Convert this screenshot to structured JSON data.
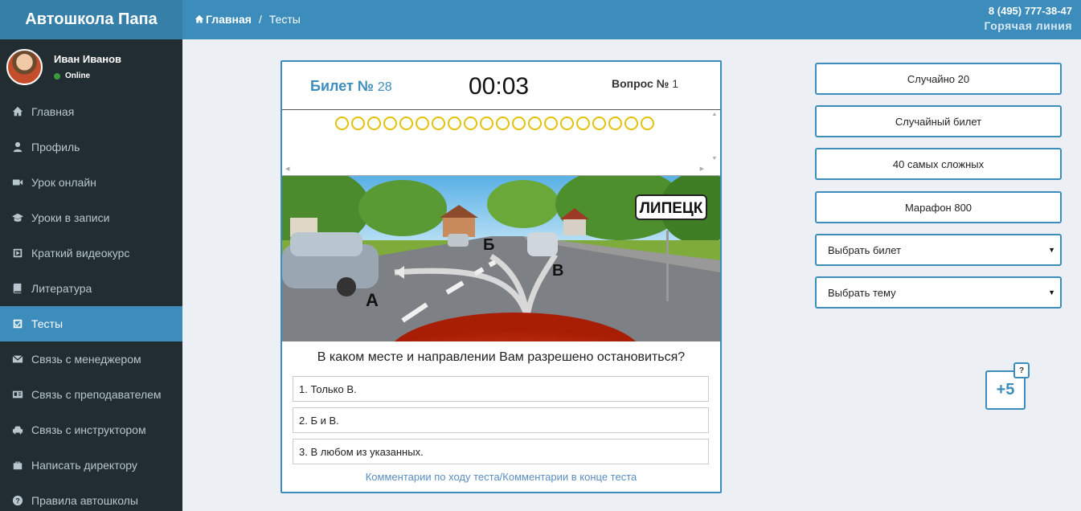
{
  "app": {
    "title": "Автошкола Папа"
  },
  "user": {
    "name": "Иван Иванов",
    "status": "Online"
  },
  "sidebar": {
    "items": [
      {
        "label": "Главная",
        "icon": "home-icon"
      },
      {
        "label": "Профиль",
        "icon": "user-icon"
      },
      {
        "label": "Урок онлайн",
        "icon": "video-camera-icon"
      },
      {
        "label": "Уроки в записи",
        "icon": "graduation-cap-icon"
      },
      {
        "label": "Краткий видеокурс",
        "icon": "play-square-icon"
      },
      {
        "label": "Литература",
        "icon": "book-icon"
      },
      {
        "label": "Тесты",
        "icon": "check-square-icon",
        "active": true
      },
      {
        "label": "Связь с менеджером",
        "icon": "envelope-icon"
      },
      {
        "label": "Связь с преподавателем",
        "icon": "id-card-icon"
      },
      {
        "label": "Связь с инструктором",
        "icon": "car-icon"
      },
      {
        "label": "Написать директору",
        "icon": "briefcase-icon"
      },
      {
        "label": "Правила автошколы",
        "icon": "question-circle-icon"
      }
    ]
  },
  "header": {
    "breadcrumb": {
      "home": "Главная",
      "sep": "/",
      "current": "Тесты"
    },
    "phone": "8 (495) 777-38-47",
    "hotline_label": "Горячая линия"
  },
  "test": {
    "ticket_label": "Билет №",
    "ticket_number": "28",
    "timer": "00:03",
    "question_label": "Вопрос №",
    "question_number": "1",
    "progress_count": 20,
    "scene": {
      "sign": "ЛИПЕЦК",
      "mark_a": "А",
      "mark_b": "Б",
      "mark_c": "В"
    },
    "question": "В каком месте и направлении Вам разрешено остановиться?",
    "answers": [
      "1. Только В.",
      "2. Б и В.",
      "3. В любом из указанных."
    ],
    "comments_link": "Комментарии по ходу теста/Комментарии в конце теста"
  },
  "actions": {
    "random20": "Случайно 20",
    "random_ticket": "Случайный билет",
    "hardest40": "40 самых сложных",
    "marathon": "Марафон 800",
    "select_ticket": "Выбрать билет",
    "select_topic": "Выбрать тему"
  },
  "bonus": {
    "value": "+5",
    "help": "?"
  },
  "colors": {
    "accent": "#3c8dbc",
    "sidebar": "#222d32",
    "progress_circle": "#e3c10a"
  }
}
